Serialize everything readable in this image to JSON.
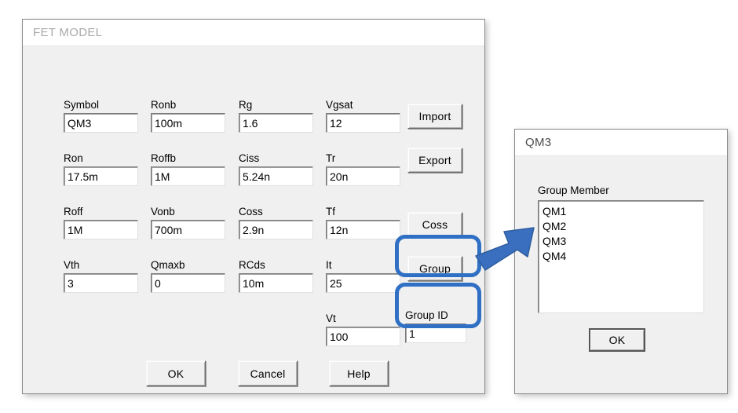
{
  "main_dialog": {
    "title": "FET MODEL",
    "fields": [
      {
        "label": "Symbol",
        "value": "QM3",
        "col": 0,
        "row": 0
      },
      {
        "label": "Ron",
        "value": "17.5m",
        "col": 0,
        "row": 1
      },
      {
        "label": "Roff",
        "value": "1M",
        "col": 0,
        "row": 2
      },
      {
        "label": "Vth",
        "value": "3",
        "col": 0,
        "row": 3
      },
      {
        "label": "Ronb",
        "value": "100m",
        "col": 1,
        "row": 0
      },
      {
        "label": "Roffb",
        "value": "1M",
        "col": 1,
        "row": 1
      },
      {
        "label": "Vonb",
        "value": "700m",
        "col": 1,
        "row": 2
      },
      {
        "label": "Qmaxb",
        "value": "0",
        "col": 1,
        "row": 3
      },
      {
        "label": "Rg",
        "value": "1.6",
        "col": 2,
        "row": 0
      },
      {
        "label": "Ciss",
        "value": "5.24n",
        "col": 2,
        "row": 1
      },
      {
        "label": "Coss",
        "value": "2.9n",
        "col": 2,
        "row": 2
      },
      {
        "label": "RCds",
        "value": "10m",
        "col": 2,
        "row": 3
      },
      {
        "label": "Vgsat",
        "value": "12",
        "col": 3,
        "row": 0
      },
      {
        "label": "Tr",
        "value": "20n",
        "col": 3,
        "row": 1
      },
      {
        "label": "Tf",
        "value": "12n",
        "col": 3,
        "row": 2
      },
      {
        "label": "It",
        "value": "25",
        "col": 3,
        "row": 3
      },
      {
        "label": "Vt",
        "value": "100",
        "col": 3,
        "row": 4
      }
    ],
    "side_buttons": [
      {
        "label": "Import"
      },
      {
        "label": "Export"
      },
      {
        "label": "Coss"
      },
      {
        "label": "Group"
      }
    ],
    "group_id": {
      "label": "Group ID",
      "value": "1"
    },
    "bottom_buttons": [
      {
        "label": "OK"
      },
      {
        "label": "Cancel"
      },
      {
        "label": "Help"
      }
    ]
  },
  "group_dialog": {
    "title": "QM3",
    "list_label": "Group Member",
    "members": [
      "QM1",
      "QM2",
      "QM3",
      "QM4"
    ],
    "ok_label": "OK"
  },
  "annotations": {
    "highlight_color": "#2f6fc4",
    "arrow_color": "#3a6fbf"
  }
}
